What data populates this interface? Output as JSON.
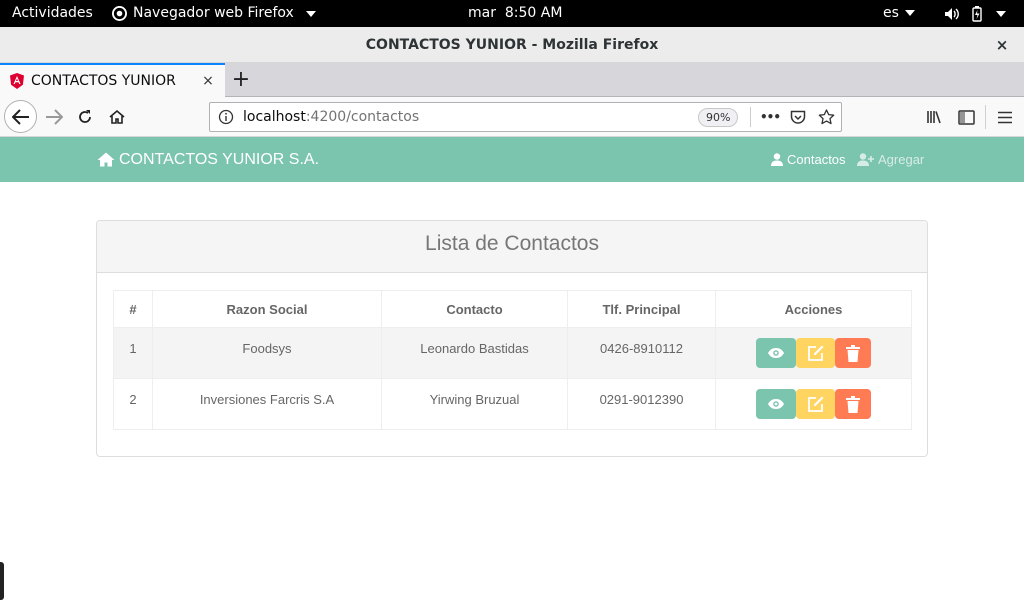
{
  "system_bar": {
    "activities": "Actividades",
    "app_menu": "Navegador web Firefox",
    "clock": "mar  8:50 AM",
    "language": "es"
  },
  "window": {
    "title": "CONTACTOS YUNIOR - Mozilla Firefox",
    "close": "×"
  },
  "tab": {
    "label": "CONTACTOS YUNIOR",
    "close": "×",
    "new_tab": "+"
  },
  "urlbar": {
    "host": "localhost",
    "path": ":4200/contactos",
    "zoom": "90%",
    "more": "•••"
  },
  "app": {
    "brand": "CONTACTOS YUNIOR S.A.",
    "nav": [
      {
        "label": "Contactos"
      },
      {
        "label": "Agregar"
      }
    ],
    "colors": {
      "primary": "#7bc4ad",
      "warning": "#ffd460",
      "danger": "#ff7b53"
    }
  },
  "panel": {
    "title": "Lista de Contactos",
    "columns": [
      "#",
      "Razon Social",
      "Contacto",
      "Tlf. Principal",
      "Acciones"
    ],
    "rows": [
      {
        "num": "1",
        "razon": "Foodsys",
        "contacto": "Leonardo Bastidas",
        "tlf": "0426-8910112"
      },
      {
        "num": "2",
        "razon": "Inversiones Farcris S.A",
        "contacto": "Yirwing Bruzual",
        "tlf": "0291-9012390"
      }
    ]
  }
}
